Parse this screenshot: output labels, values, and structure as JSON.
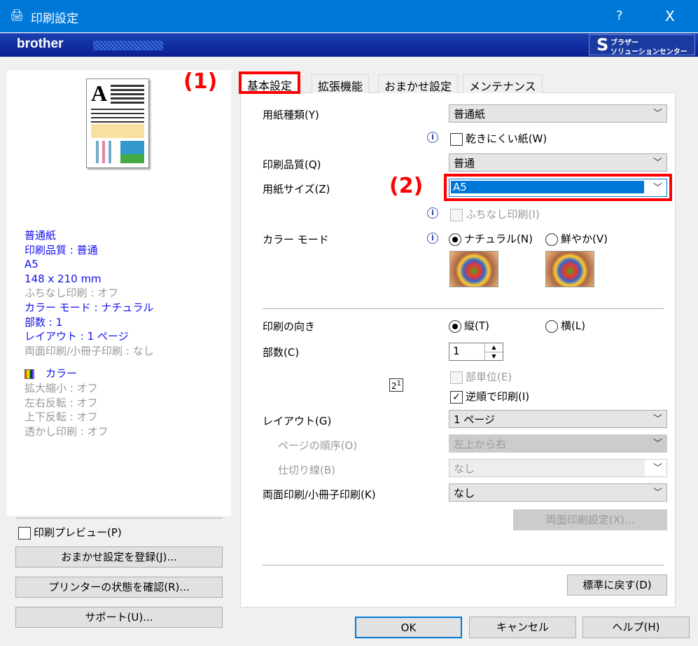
{
  "window": {
    "title": "印刷設定",
    "help": "?",
    "close": "X",
    "icon": "printer-icon"
  },
  "banner": {
    "logo": "brother",
    "solutions_line1": "ブラザー",
    "solutions_line2": "ソリューションセンター"
  },
  "annotations": {
    "tab_marker": "(1)",
    "size_marker": "(2)",
    "marker_color": "#ff0000"
  },
  "summary": {
    "paper_type": "普通紙",
    "quality": "印刷品質 : 普通",
    "size": "A5",
    "dimensions": "148 x 210 mm",
    "borderless": "ふちなし印刷 : オフ",
    "color_mode": "カラー モード : ナチュラル",
    "copies": "部数 : 1",
    "layout": "レイアウト : 1 ページ",
    "duplex": "両面印刷/小冊子印刷 : なし",
    "color": "カラー",
    "scaling": "拡大縮小 : オフ",
    "mirror": "左右反転 : オフ",
    "flip": "上下反転 : オフ",
    "watermark": "透かし印刷 : オフ"
  },
  "left_controls": {
    "preview": "印刷プレビュー(P)",
    "register": "おまかせ設定を登録(J)...",
    "status": "プリンターの状態を確認(R)...",
    "support": "サポート(U)..."
  },
  "tabs": [
    {
      "label": "基本設定",
      "active": true
    },
    {
      "label": "拡張機能"
    },
    {
      "label": "おまかせ設定"
    },
    {
      "label": "メンテナンス"
    }
  ],
  "form": {
    "paper_type_label": "用紙種類(Y)",
    "paper_type_value": "普通紙",
    "slow_dry": "乾きにくい紙(W)",
    "quality_label": "印刷品質(Q)",
    "quality_value": "普通",
    "size_label": "用紙サイズ(Z)",
    "size_value": "A5",
    "borderless": "ふちなし印刷(I)",
    "color_mode_label": "カラー モード",
    "natural": "ナチュラル(N)",
    "vivid": "鮮やか(V)",
    "orientation_label": "印刷の向き",
    "portrait": "縦(T)",
    "landscape": "横(L)",
    "copies_label": "部数(C)",
    "copies_value": "1",
    "collate": "部単位(E)",
    "reverse": "逆順で印刷(I)",
    "layout_label": "レイアウト(G)",
    "layout_value": "1 ページ",
    "page_order_label": "ページの順序(O)",
    "page_order_value": "左上から右",
    "border_line_label": "仕切り線(B)",
    "border_line_value": "なし",
    "duplex_label": "両面印刷/小冊子印刷(K)",
    "duplex_value": "なし",
    "duplex_settings": "両面印刷設定(X)...",
    "default": "標準に戻す(D)"
  },
  "footer": {
    "ok": "OK",
    "cancel": "キャンセル",
    "help": "ヘルプ(H)"
  }
}
